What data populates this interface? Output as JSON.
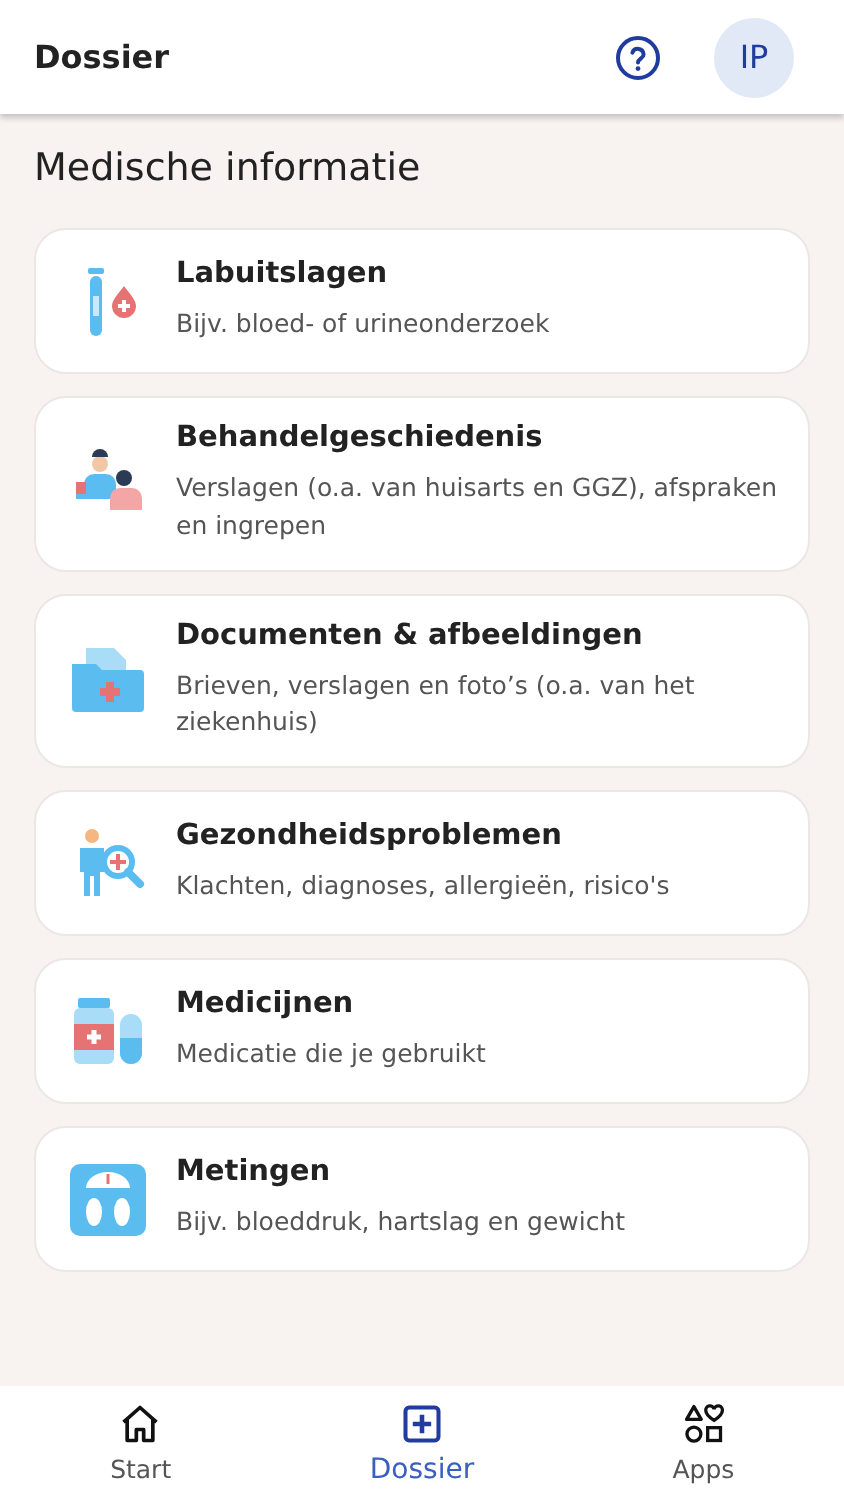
{
  "header": {
    "title": "Dossier",
    "avatar": "IP"
  },
  "section": {
    "title": "Medische informatie",
    "items": [
      {
        "title": "Labuitslagen",
        "description": "Bijv. bloed- of urineonderzoek"
      },
      {
        "title": "Behandelgeschiedenis",
        "description": "Verslagen (o.a. van huisarts en GGZ), afspraken en ingrepen"
      },
      {
        "title": "Documenten & afbeeldingen",
        "description": "Brieven, verslagen en foto’s (o.a. van het ziekenhuis)"
      },
      {
        "title": "Gezondheidsproblemen",
        "description": "Klachten, diagnoses, allergieën, risico's"
      },
      {
        "title": "Medicijnen",
        "description": "Medicatie die je gebruikt"
      },
      {
        "title": "Metingen",
        "description": "Bijv. bloeddruk, hartslag en gewicht"
      }
    ]
  },
  "bottom_nav": [
    {
      "label": "Start",
      "selected": false
    },
    {
      "label": "Dossier",
      "selected": true
    },
    {
      "label": "Apps",
      "selected": false
    }
  ]
}
